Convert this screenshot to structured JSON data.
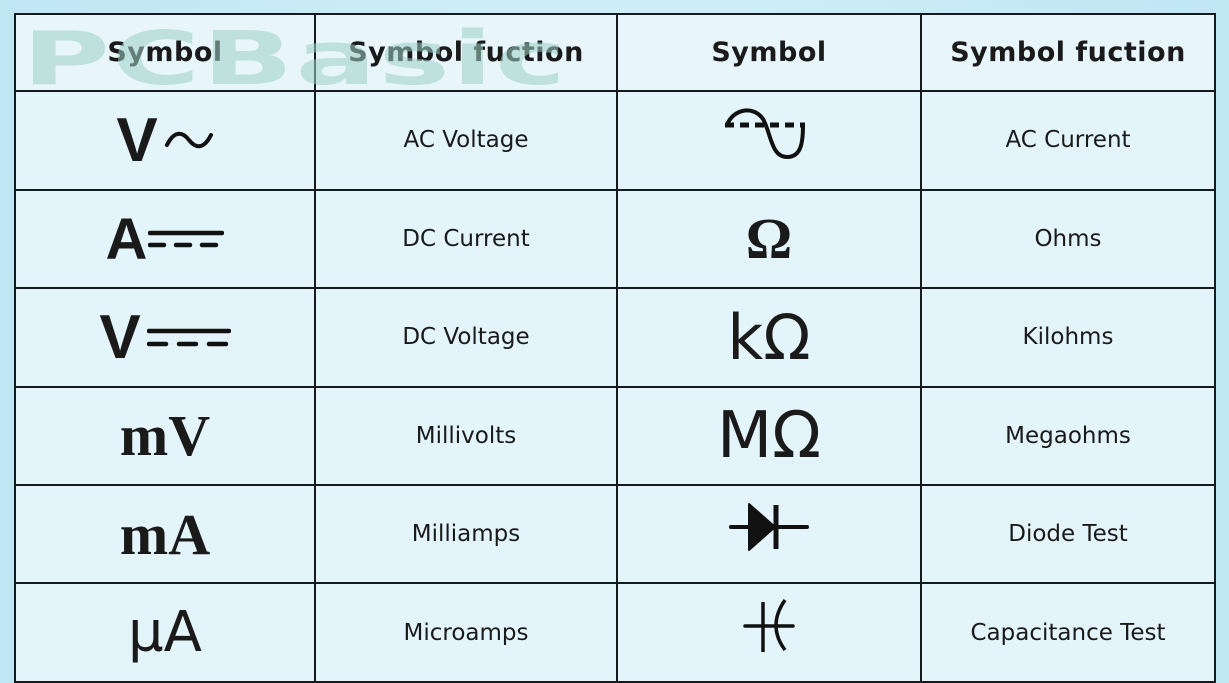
{
  "watermark": "PCBasic",
  "headers": [
    "Symbol",
    "Symbol fuction",
    "Symbol",
    "Symbol fuction"
  ],
  "rows": [
    {
      "left": {
        "symbol": "V",
        "symbol_icon": "ac-tilde-icon",
        "function": "AC Voltage"
      },
      "right": {
        "symbol": "",
        "symbol_icon": "ac-current-sine-icon",
        "function": "AC Current"
      }
    },
    {
      "left": {
        "symbol": "A",
        "symbol_icon": "dc-lines-icon",
        "function": "DC Current"
      },
      "right": {
        "symbol": "Ω",
        "symbol_icon": "",
        "function": "Ohms"
      }
    },
    {
      "left": {
        "symbol": "V",
        "symbol_icon": "dc-lines-icon",
        "function": "DC Voltage"
      },
      "right": {
        "symbol": "kΩ",
        "symbol_icon": "",
        "function": "Kilohms"
      }
    },
    {
      "left": {
        "symbol": "mV",
        "symbol_icon": "",
        "function": "Millivolts"
      },
      "right": {
        "symbol": "MΩ",
        "symbol_icon": "",
        "function": "Megaohms"
      }
    },
    {
      "left": {
        "symbol": "mA",
        "symbol_icon": "",
        "function": "Milliamps"
      },
      "right": {
        "symbol": "",
        "symbol_icon": "diode-icon",
        "function": "Diode Test"
      }
    },
    {
      "left": {
        "symbol": "µA",
        "symbol_icon": "",
        "function": "Microamps"
      },
      "right": {
        "symbol": "",
        "symbol_icon": "capacitor-icon",
        "function": "Capacitance Test"
      }
    }
  ],
  "colors": {
    "background": "#cdeef8",
    "table_fill": "#e3f4fb",
    "border": "#141a1e",
    "watermark": "#9fd1c6"
  }
}
